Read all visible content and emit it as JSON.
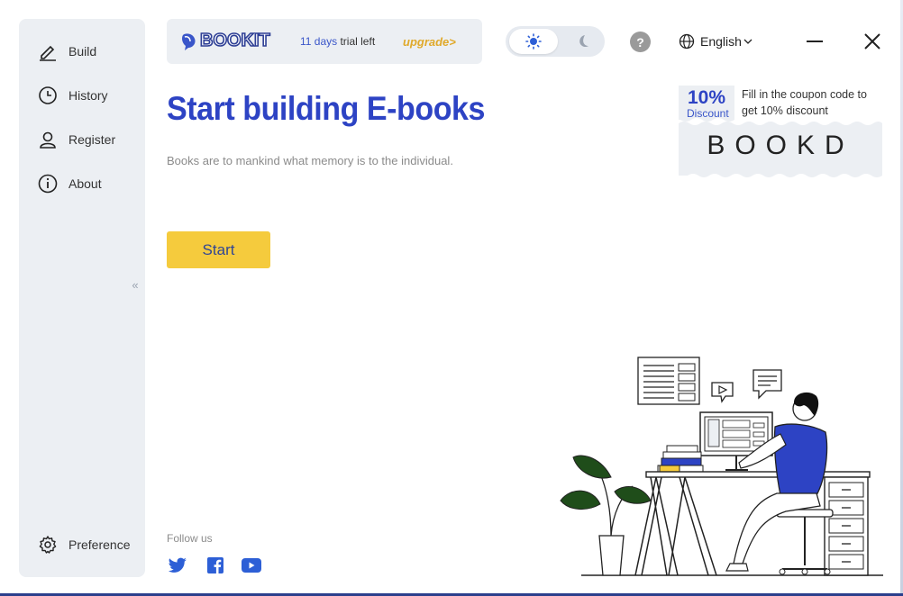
{
  "sidebar": {
    "items": [
      {
        "label": "Build",
        "icon": "pen-icon"
      },
      {
        "label": "History",
        "icon": "clock-icon"
      },
      {
        "label": "Register",
        "icon": "user-icon"
      },
      {
        "label": "About",
        "icon": "info-icon"
      }
    ],
    "preference": {
      "label": "Preference",
      "icon": "gear-icon"
    },
    "collapse_glyph": "«"
  },
  "header": {
    "logo_text": "BOOKIT",
    "trial_days": "11 days",
    "trial_suffix": " trial left",
    "upgrade_label": "upgrade>",
    "help_label": "?",
    "language": "English"
  },
  "main": {
    "title": "Start building E-books",
    "subtitle": "Books are to mankind what memory is to the individual.",
    "start_label": "Start"
  },
  "coupon": {
    "percent": "10%",
    "discount_label": "Discount",
    "description": "Fill in the coupon code to get 10% discount",
    "code": "BOOKD"
  },
  "footer": {
    "follow_label": "Follow us",
    "social": [
      "twitter-icon",
      "facebook-icon",
      "youtube-icon"
    ]
  },
  "colors": {
    "accent": "#2d43c4",
    "button": "#f5cb3d",
    "upgrade": "#e0a92a",
    "sidebar_bg": "#eceff3"
  }
}
